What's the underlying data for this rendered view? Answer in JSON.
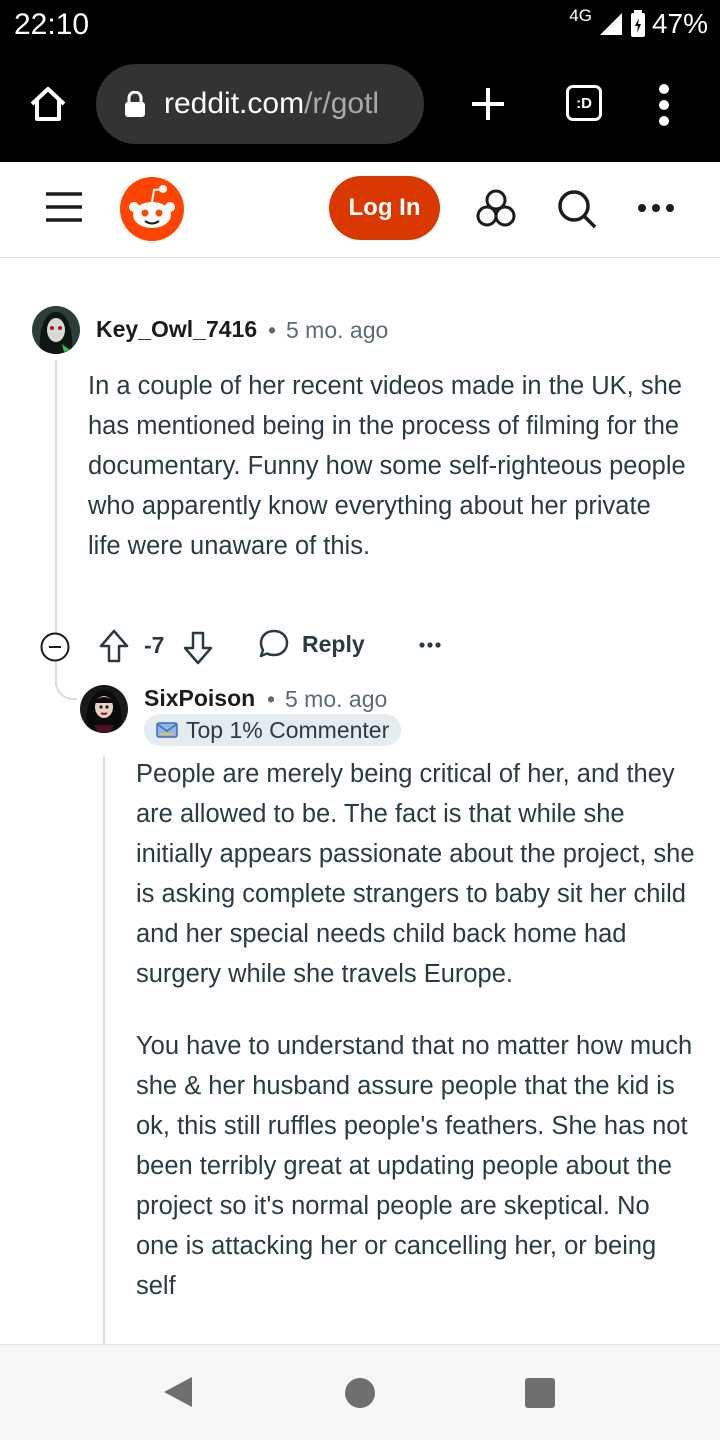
{
  "status_bar": {
    "time": "22:10",
    "network": "4G",
    "battery": "47%"
  },
  "browser": {
    "url_domain": "reddit.com",
    "url_path": "/r/gotl",
    "tabs_label": ":D"
  },
  "header": {
    "login_label": "Log In"
  },
  "comments": [
    {
      "username": "Key_Owl_7416",
      "separator": "•",
      "age": "5 mo. ago",
      "body": "In a couple of her recent videos made in the UK, she has mentioned being in the process of filming for the documentary. Funny how some self-righteous people who apparently know everything about her private life were unaware of this.",
      "score": "-7",
      "reply_label": "Reply"
    },
    {
      "username": "SixPoison",
      "separator": "•",
      "age": "5 mo. ago",
      "badge": "Top 1% Commenter",
      "paragraphs": [
        "People are merely being critical of her, and they are allowed to be. The fact is that while she initially appears passionate about the project, she is asking complete strangers to baby sit her child and her special needs child back home had surgery while she travels Europe.",
        "You have to understand that no matter how much she & her husband assure people that the kid is ok, this still ruffles people's feathers. She has not been terribly great at updating people about the project so it's normal people are skeptical. No one is attacking her or cancelling her, or being self"
      ]
    }
  ],
  "colors": {
    "brand": "#ff4500",
    "login_bg": "#d93900",
    "meta_text": "#5c6c74",
    "body_text": "#2a3c42"
  },
  "icons": {
    "home": "home-icon",
    "lock": "lock-icon",
    "new_tab": "plus-icon",
    "tabs": "tab-switcher-icon",
    "menu": "vertical-dots-icon",
    "hamburger": "hamburger-icon",
    "logo": "reddit-snoo-logo",
    "communities": "nodes-icon",
    "search": "search-icon",
    "more": "horizontal-dots-icon",
    "collapse": "minus-circle-icon",
    "upvote": "arrow-up-icon",
    "downvote": "arrow-down-icon",
    "reply": "speech-bubble-icon",
    "badge": "envelope-badge-icon"
  }
}
